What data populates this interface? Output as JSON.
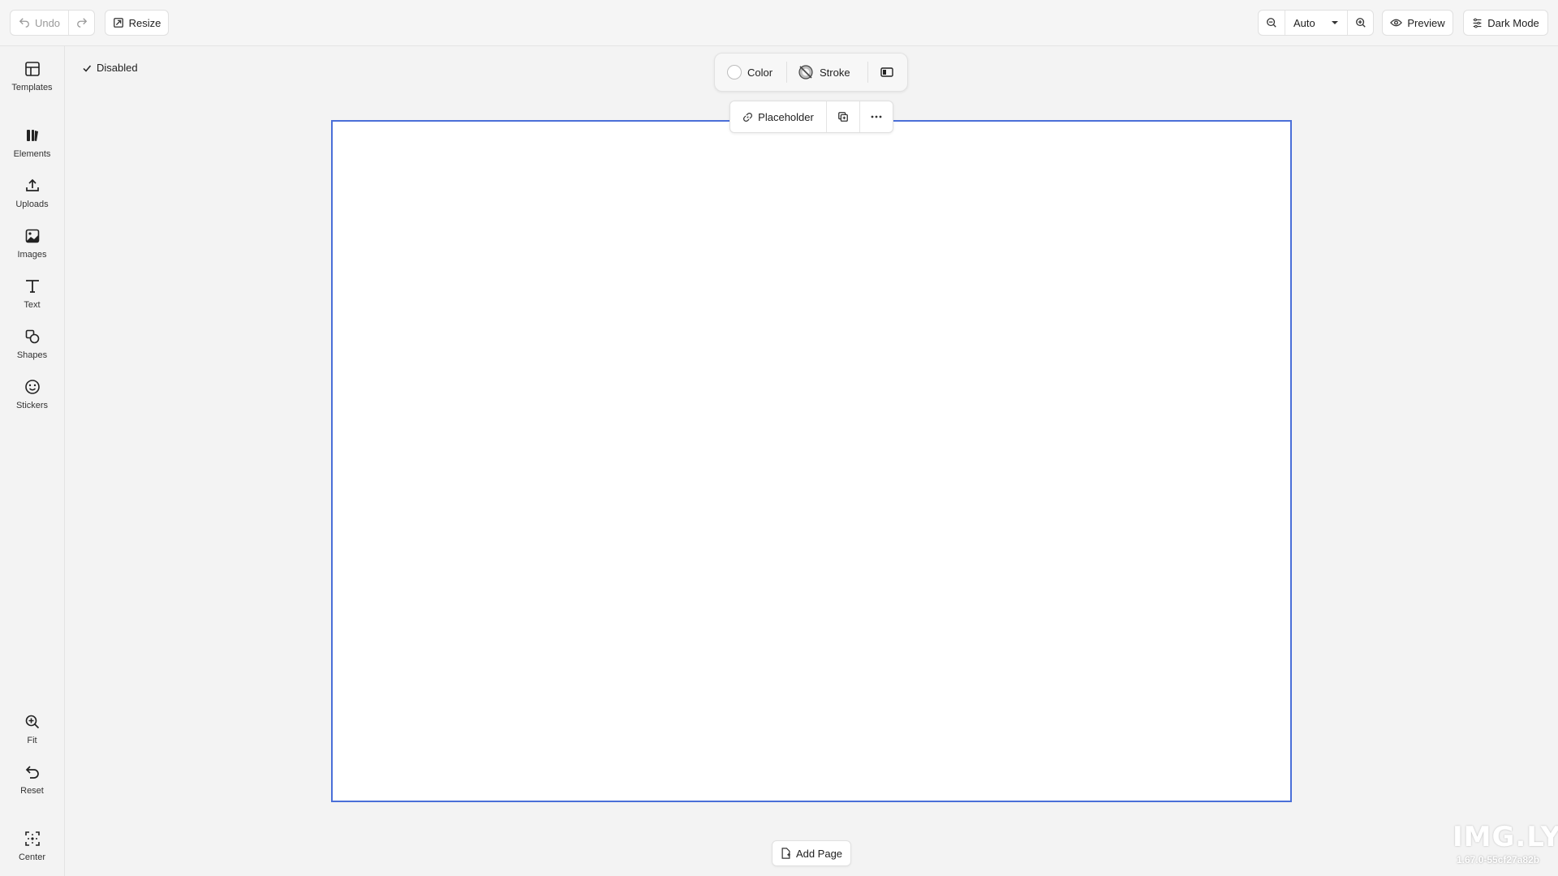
{
  "toolbar": {
    "undo_label": "Undo",
    "resize_label": "Resize",
    "zoom_value": "Auto",
    "preview_label": "Preview",
    "dark_mode_label": "Dark Mode"
  },
  "sidebar": {
    "items": [
      {
        "label": "Templates",
        "icon": "templates-icon"
      },
      {
        "label": "Elements",
        "icon": "elements-icon"
      },
      {
        "label": "Uploads",
        "icon": "upload-icon"
      },
      {
        "label": "Images",
        "icon": "image-icon"
      },
      {
        "label": "Text",
        "icon": "text-icon"
      },
      {
        "label": "Shapes",
        "icon": "shapes-icon"
      },
      {
        "label": "Stickers",
        "icon": "sticker-icon"
      }
    ],
    "bottom": [
      {
        "label": "Fit",
        "icon": "zoom-fit-icon"
      },
      {
        "label": "Reset",
        "icon": "reset-icon"
      },
      {
        "label": "Center",
        "icon": "center-icon"
      }
    ]
  },
  "status": {
    "disabled_label": "Disabled"
  },
  "fill_toolbar": {
    "color_label": "Color",
    "stroke_label": "Stroke"
  },
  "block_toolbar": {
    "placeholder_label": "Placeholder"
  },
  "footer": {
    "add_page_label": "Add Page"
  },
  "branding": {
    "logo": "IMG.LY",
    "version": "1.67.0-55cf27a82b"
  },
  "colors": {
    "page_border": "#4a6fd8",
    "background": "#f3f3f3"
  }
}
